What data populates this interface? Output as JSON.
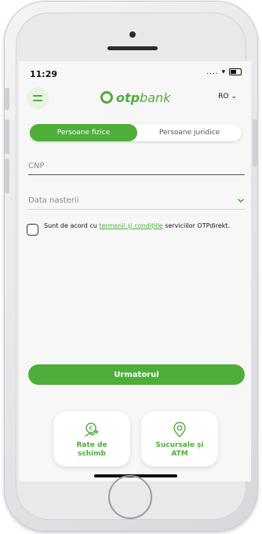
{
  "status_bar": {
    "time": "11:29",
    "icons": "... ▾"
  },
  "header": {
    "logo_text": "otp",
    "logo_text_2": "bank",
    "language": "RO"
  },
  "tabs": [
    {
      "label": "Persoane fizice",
      "active": true
    },
    {
      "label": "Persoane juridice",
      "active": false
    }
  ],
  "form": {
    "cnp_placeholder": "CNP",
    "birthdate_placeholder": "Data nasterii"
  },
  "consent": {
    "prefix": "Sunt de acord cu ",
    "link_text": "termenii și condițiile",
    "suffix": " serviciilor OTPdirekt."
  },
  "next_button": "Urmatorul",
  "shortcuts": [
    {
      "label": "Rate de\nschimb",
      "icon": "exchange-rate-icon"
    },
    {
      "label": "Sucursale și\nATM",
      "icon": "location-pin-icon"
    }
  ],
  "colors": {
    "accent": "#4eae3a",
    "background": "#f7f7f7"
  }
}
